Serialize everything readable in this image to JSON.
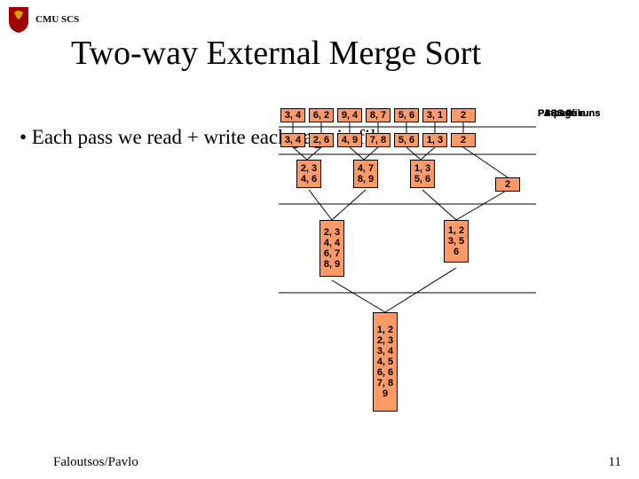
{
  "hdr": {
    "org": "CMU SCS"
  },
  "title": "Two-way External Merge Sort",
  "bullet": "• Each pass we read + write each page in file.",
  "footer": "Faloutsos/Pavlo",
  "pagenum": "11",
  "diag": {
    "row_input": [
      "3, 4",
      "6, 2",
      "9, 4",
      "8, 7",
      "5, 6",
      "3, 1",
      "2"
    ],
    "row_pass0": [
      "3, 4",
      "2, 6",
      "4, 9",
      "7, 8",
      "5, 6",
      "1, 3",
      "2"
    ],
    "row_pass1_a": [
      "2, 3",
      "4, 6"
    ],
    "row_pass1_b": [
      "4, 7",
      "8, 9"
    ],
    "row_pass1_c": [
      "1, 3",
      "5, 6"
    ],
    "row_pass1_d": [
      "2"
    ],
    "row_pass2_a": [
      "2, 3",
      "4, 4",
      "6, 7",
      "8, 9"
    ],
    "row_pass2_b": [
      "1, 2",
      "3, 5",
      "6"
    ],
    "row_pass3": [
      "1, 2",
      "2, 3",
      "3, 4",
      "4, 5",
      "6, 6",
      "7, 8",
      "9"
    ],
    "lbl_input": "Input file",
    "lbl_p0": "PASS 0",
    "lbl_1p": "1-page runs",
    "lbl_p1": "PASS 1",
    "lbl_2p": "2-page runs",
    "lbl_p2": "PASS 2",
    "lbl_4p": "4-page runs",
    "lbl_p3": "PASS 3",
    "lbl_8p": "8-page runs"
  }
}
